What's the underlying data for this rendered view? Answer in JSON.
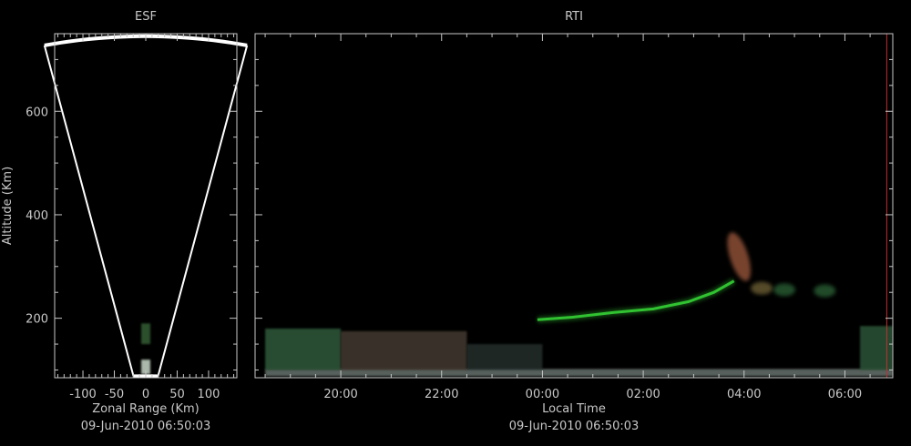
{
  "chart_data": [
    {
      "type": "heatmap",
      "title": "ESF",
      "xlabel": "Zonal Range (Km)",
      "ylabel": "Altitude (Km)",
      "timestamp": "09-Jun-2010 06:50:03",
      "xlim": [
        -145,
        145
      ],
      "ylim": [
        85,
        750
      ],
      "x_ticks": [
        -100,
        -50,
        0,
        50,
        100
      ],
      "x_tick_labels": [
        "-100",
        "-50",
        "0",
        "50",
        "100"
      ],
      "y_ticks": [
        200,
        400,
        600
      ],
      "y_tick_labels": [
        "200",
        "400",
        "600"
      ],
      "fan_beam": {
        "apex_range_km": 90,
        "max_range_km": 745,
        "half_angle_deg": 12.5
      },
      "echoes": [
        {
          "x": 0,
          "y_from": 150,
          "y_to": 190,
          "color": "#3a6a3a",
          "opacity": 0.75
        },
        {
          "x": 0,
          "y_from": 92,
          "y_to": 120,
          "color": "#c8d8c8",
          "opacity": 0.85
        }
      ],
      "colors": {
        "outline": "#ffffff",
        "background": "#000000",
        "axis": "#c8c8c8"
      }
    },
    {
      "type": "heatmap",
      "title": "RTI",
      "xlabel": "Local Time",
      "timestamp": "09-Jun-2010 06:50:03",
      "xlim_hours": [
        18.3,
        30.95
      ],
      "ylim": [
        85,
        750
      ],
      "x_ticks_hours": [
        20,
        22,
        24,
        26,
        28,
        30
      ],
      "x_tick_labels": [
        "20:00",
        "22:00",
        "00:00",
        "02:00",
        "04:00",
        "06:00"
      ],
      "y_ticks": [
        200,
        400,
        600
      ],
      "current_time_hours": 30.83,
      "features": [
        {
          "name": "e-region-band",
          "t_from": 18.5,
          "t_to": 30.95,
          "alt_from": 88,
          "alt_to": 102,
          "color": "#9fb0a8",
          "opacity": 0.55
        },
        {
          "name": "lower-echoes-green",
          "t_from": 18.5,
          "t_to": 20.0,
          "alt_from": 100,
          "alt_to": 180,
          "color": "#2d5a3a",
          "opacity": 0.85
        },
        {
          "name": "lower-echoes-brown",
          "t_from": 20.0,
          "t_to": 22.5,
          "alt_from": 100,
          "alt_to": 175,
          "color": "#4a3c34",
          "opacity": 0.8
        },
        {
          "name": "lower-echoes-gray",
          "t_from": 22.5,
          "t_to": 24.0,
          "alt_from": 100,
          "alt_to": 150,
          "color": "#2c3530",
          "opacity": 0.75
        },
        {
          "name": "lower-echoes-late",
          "t_from": 30.3,
          "t_to": 30.95,
          "alt_from": 100,
          "alt_to": 185,
          "color": "#2d5a3a",
          "opacity": 0.8
        }
      ],
      "f_layer_trace": [
        {
          "t": 23.9,
          "alt": 197
        },
        {
          "t": 24.6,
          "alt": 202
        },
        {
          "t": 25.4,
          "alt": 211
        },
        {
          "t": 26.2,
          "alt": 218
        },
        {
          "t": 26.9,
          "alt": 232
        },
        {
          "t": 27.4,
          "alt": 250
        },
        {
          "t": 27.8,
          "alt": 272
        }
      ],
      "plume": {
        "t": 27.9,
        "alt_from": 270,
        "alt_to": 368,
        "color": "#a05a3c"
      },
      "patches": [
        {
          "t": 28.35,
          "alt": 258,
          "color": "#7a6a3a"
        },
        {
          "t": 28.8,
          "alt": 255,
          "color": "#2f6a3a"
        },
        {
          "t": 29.6,
          "alt": 253,
          "color": "#2f6a3a"
        }
      ],
      "colors": {
        "trace": "#35d035",
        "background": "#000000",
        "axis": "#c8c8c8",
        "time_marker": "#c03030"
      }
    }
  ]
}
